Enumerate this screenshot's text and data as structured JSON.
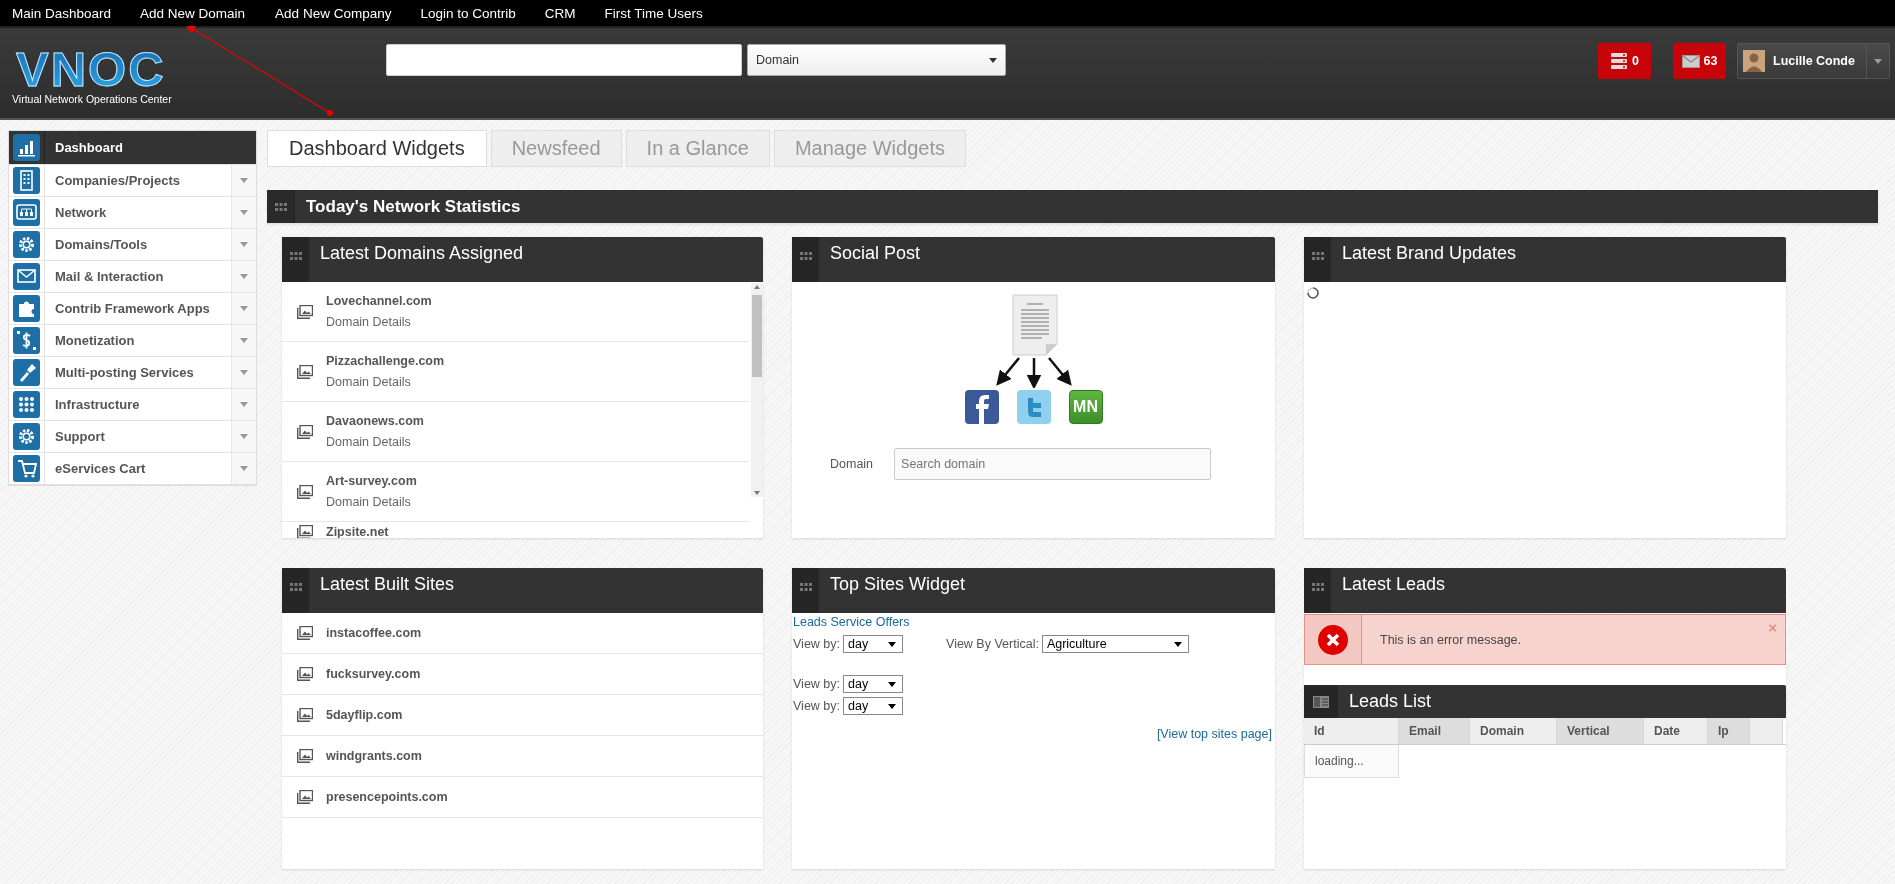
{
  "top_nav": [
    {
      "label": "Main Dashboard"
    },
    {
      "label": "Add New Domain"
    },
    {
      "label": "Add New Company"
    },
    {
      "label": "Login to Contrib"
    },
    {
      "label": "CRM"
    },
    {
      "label": "First Time Users"
    }
  ],
  "header": {
    "logo": {
      "title": "VNOC",
      "subtitle": "Virtual Network Operations Center"
    },
    "search_type": {
      "value": "Domain"
    },
    "badges": [
      {
        "kind": "server",
        "count": "0"
      },
      {
        "kind": "mail",
        "count": "63"
      }
    ],
    "user": {
      "name": "Lucille Conde"
    }
  },
  "sidebar": {
    "items": [
      {
        "label": "Dashboard",
        "selected": true,
        "expandable": false
      },
      {
        "label": "Companies/Projects",
        "selected": false,
        "expandable": true
      },
      {
        "label": "Network",
        "selected": false,
        "expandable": true
      },
      {
        "label": "Domains/Tools",
        "selected": false,
        "expandable": true
      },
      {
        "label": "Mail & Interaction",
        "selected": false,
        "expandable": true
      },
      {
        "label": "Contrib Framework Apps",
        "selected": false,
        "expandable": true
      },
      {
        "label": "Monetization",
        "selected": false,
        "expandable": true
      },
      {
        "label": "Multi-posting Services",
        "selected": false,
        "expandable": true
      },
      {
        "label": "Infrastructure",
        "selected": false,
        "expandable": true
      },
      {
        "label": "Support",
        "selected": false,
        "expandable": true
      },
      {
        "label": "eServices Cart",
        "selected": false,
        "expandable": true
      }
    ]
  },
  "tabs": [
    {
      "label": "Dashboard Widgets",
      "selected": true
    },
    {
      "label": "Newsfeed",
      "selected": false
    },
    {
      "label": "In a Glance",
      "selected": false
    },
    {
      "label": "Manage Widgets",
      "selected": false
    }
  ],
  "section_title": "Today's Network Statistics",
  "widgets": [
    {
      "kind": "domain_list",
      "title": "Latest Domains Assigned",
      "items": [
        {
          "name": "Lovechannel.com",
          "detail": "Domain Details"
        },
        {
          "name": "Pizzachallenge.com",
          "detail": "Domain Details"
        },
        {
          "name": "Davaonews.com",
          "detail": "Domain Details"
        },
        {
          "name": "Art-survey.com",
          "detail": "Domain Details"
        },
        {
          "name": "Zipsite.net"
        }
      ]
    },
    {
      "kind": "social_post",
      "title": "Social Post",
      "networks": [
        {
          "kind": "facebook"
        },
        {
          "kind": "twitter"
        },
        {
          "kind": "badge",
          "text": "MN"
        }
      ],
      "field_label": "Domain",
      "placeholder": "Search domain"
    },
    {
      "kind": "loading",
      "title": "Latest Brand Updates"
    },
    {
      "kind": "site_list",
      "title": "Latest Built Sites",
      "items": [
        {
          "name": "instacoffee.com"
        },
        {
          "name": "fucksurvey.com"
        },
        {
          "name": "5dayflip.com"
        },
        {
          "name": "windgrants.com"
        },
        {
          "name": "presencepoints.com"
        }
      ]
    },
    {
      "kind": "top_sites",
      "title": "Top Sites Widget",
      "link": "Leads Service Offers",
      "filters": [
        {
          "label": "View by:",
          "value": "day",
          "extra_label": "View By Vertical:",
          "extra_value": "Agriculture"
        },
        {
          "label": "View by:",
          "value": "day"
        },
        {
          "label": "View by:",
          "value": "day"
        }
      ],
      "footer_link": "[View top sites page]"
    },
    {
      "kind": "leads",
      "title": "Latest Leads",
      "error": "This is an error message.",
      "close": "×",
      "list_title": "Leads List",
      "columns": [
        {
          "label": "Id",
          "highlighted": false
        },
        {
          "label": "Email",
          "highlighted": true
        },
        {
          "label": "Domain",
          "highlighted": false
        },
        {
          "label": "Vertical",
          "highlighted": true
        },
        {
          "label": "Date",
          "highlighted": false
        },
        {
          "label": "Ip",
          "highlighted": true
        },
        {
          "highlighted": false
        }
      ],
      "status": "loading..."
    }
  ]
}
